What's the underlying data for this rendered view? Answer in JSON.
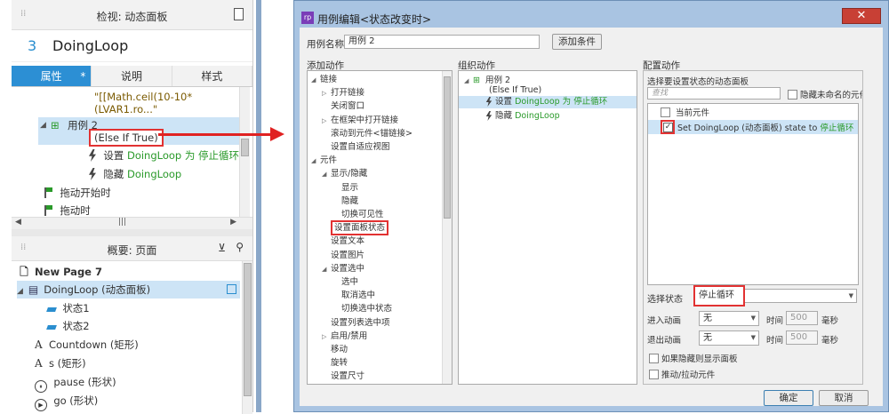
{
  "left": {
    "inspector": {
      "title": "检视: 动态面板",
      "index": "3",
      "name": "DoingLoop",
      "tabs": [
        {
          "label": "属性",
          "active": true,
          "star": "*"
        },
        {
          "label": "说明"
        },
        {
          "label": "样式"
        }
      ],
      "expr1": "\"[[Math.ceil(10-10*",
      "expr2": "(LVAR1.ro...\"",
      "case_name": "用例 2",
      "case_cond": "(Else If True)",
      "action1_prefix": "设置 ",
      "action1_value": "DoingLoop 为 停止循环",
      "action2_prefix": "隐藏 ",
      "action2_value": "DoingLoop",
      "event1": "拖动开始时",
      "event2": "拖动时"
    },
    "outline": {
      "title": "概要: 页面",
      "page": "New Page 7",
      "items": [
        {
          "label": "DoingLoop (动态面板)"
        },
        {
          "label": "状态1"
        },
        {
          "label": "状态2"
        },
        {
          "label": "Countdown (矩形)",
          "icon": "A"
        },
        {
          "label": "s (矩形)",
          "icon": "A"
        },
        {
          "label": "pause (形状)",
          "icon": "⏸"
        },
        {
          "label": "go (形状)",
          "icon": "▶"
        }
      ]
    }
  },
  "dialog": {
    "title": "用例编辑<状态改变时>",
    "close_label": "✕",
    "case_name_label": "用例名称",
    "case_name_value": "用例 2",
    "add_condition": "添加条件",
    "add_action": {
      "header": "添加动作",
      "items": [
        {
          "label": "链接",
          "exp": "◢",
          "lvl": 0
        },
        {
          "label": "打开链接",
          "exp": "▷",
          "lvl": 1
        },
        {
          "label": "关闭窗口",
          "exp": "",
          "lvl": 1
        },
        {
          "label": "在框架中打开链接",
          "exp": "▷",
          "lvl": 1
        },
        {
          "label": "滚动到元件<锚链接>",
          "exp": "",
          "lvl": 1
        },
        {
          "label": "设置自适应视图",
          "exp": "",
          "lvl": 1
        },
        {
          "label": "元件",
          "exp": "◢",
          "lvl": 0
        },
        {
          "label": "显示/隐藏",
          "exp": "◢",
          "lvl": 1
        },
        {
          "label": "显示",
          "exp": "",
          "lvl": 2
        },
        {
          "label": "隐藏",
          "exp": "",
          "lvl": 2
        },
        {
          "label": "切换可见性",
          "exp": "",
          "lvl": 2
        },
        {
          "label": "设置面板状态",
          "exp": "",
          "lvl": 1,
          "boxed": true
        },
        {
          "label": "设置文本",
          "exp": "",
          "lvl": 1
        },
        {
          "label": "设置图片",
          "exp": "",
          "lvl": 1
        },
        {
          "label": "设置选中",
          "exp": "◢",
          "lvl": 1
        },
        {
          "label": "选中",
          "exp": "",
          "lvl": 2
        },
        {
          "label": "取消选中",
          "exp": "",
          "lvl": 2
        },
        {
          "label": "切换选中状态",
          "exp": "",
          "lvl": 2
        },
        {
          "label": "设置列表选中项",
          "exp": "",
          "lvl": 1
        },
        {
          "label": "启用/禁用",
          "exp": "▷",
          "lvl": 1
        },
        {
          "label": "移动",
          "exp": "",
          "lvl": 1
        },
        {
          "label": "旋转",
          "exp": "",
          "lvl": 1
        },
        {
          "label": "设置尺寸",
          "exp": "",
          "lvl": 1
        }
      ]
    },
    "organize": {
      "header": "组织动作",
      "case": "用例 2",
      "cond": "(Else If True)",
      "a1_prefix": "设置 ",
      "a1_value": "DoingLoop 为 停止循环",
      "a2_prefix": "隐藏 ",
      "a2_value": "DoingLoop"
    },
    "config": {
      "header": "配置动作",
      "subheader": "选择要设置状态的动态面板",
      "search_placeholder": "查找",
      "hide_unnamed": "隐藏未命名的元件",
      "current_widget": "当前元件",
      "set_prefix": "Set DoingLoop (动态面板) state to ",
      "set_value": "停止循环",
      "check": "✓",
      "select_state_label": "选择状态",
      "select_state_value": "停止循环",
      "enter_anim_label": "进入动画",
      "enter_anim_value": "无",
      "exit_anim_label": "退出动画",
      "exit_anim_value": "无",
      "time_label": "时间",
      "time_value": "500",
      "ms": "毫秒",
      "opt1": "如果隐藏则显示面板",
      "opt2": "推动/拉动元件"
    },
    "ok": "确定",
    "cancel": "取消"
  }
}
